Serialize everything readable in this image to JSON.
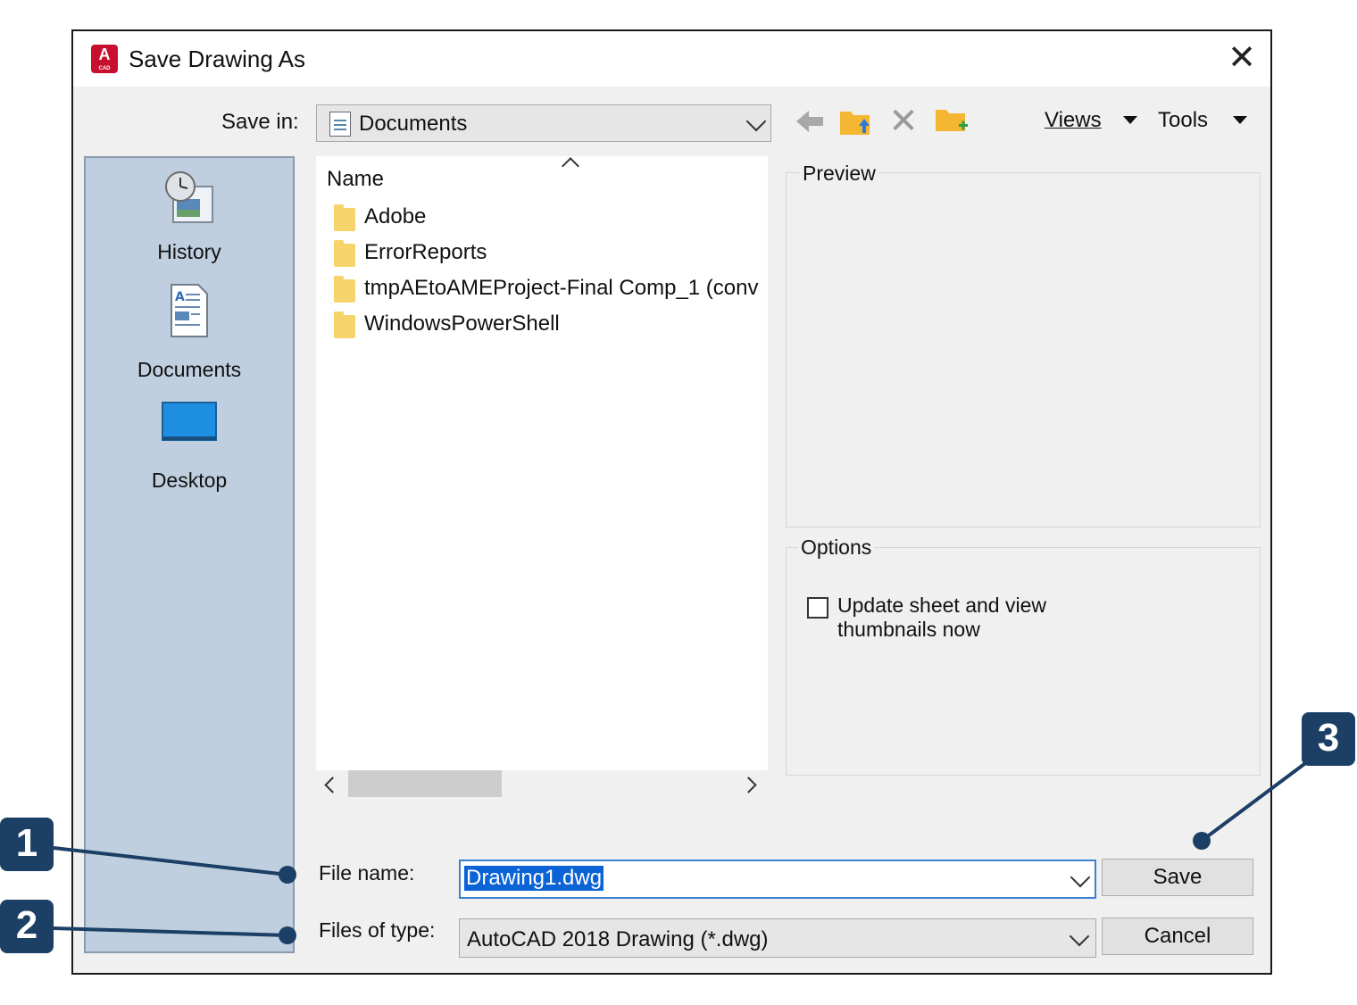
{
  "window": {
    "title": "Save Drawing As",
    "app_icon_letter": "A",
    "app_icon_sub": "CAD"
  },
  "toolbar": {
    "save_in_label": "Save in:",
    "save_in_value": "Documents",
    "views_label": "Views",
    "tools_label": "Tools"
  },
  "places": [
    {
      "label": "History",
      "icon": "history-icon"
    },
    {
      "label": "Documents",
      "icon": "documents-icon"
    },
    {
      "label": "Desktop",
      "icon": "desktop-icon"
    }
  ],
  "file_list": {
    "column": "Name",
    "items": [
      "Adobe",
      "ErrorReports",
      "tmpAEtoAMEProject-Final Comp_1 (conv",
      "WindowsPowerShell"
    ]
  },
  "preview": {
    "label": "Preview"
  },
  "options": {
    "label": "Options",
    "thumbnail_checkbox": "Update sheet and view thumbnails now",
    "thumbnail_checked": false
  },
  "form": {
    "file_name_label": "File name:",
    "file_name_value": "Drawing1.dwg",
    "files_of_type_label": "Files of type:",
    "files_of_type_value": "AutoCAD 2018 Drawing (*.dwg)",
    "save_label": "Save",
    "cancel_label": "Cancel"
  },
  "callouts": [
    "1",
    "2",
    "3"
  ],
  "colors": {
    "dialog_bg": "#f0f0f0",
    "places_bg": "#bfcfdf",
    "selection": "#0b63d6",
    "callout": "#1c3f66",
    "app_icon": "#c8102e"
  }
}
